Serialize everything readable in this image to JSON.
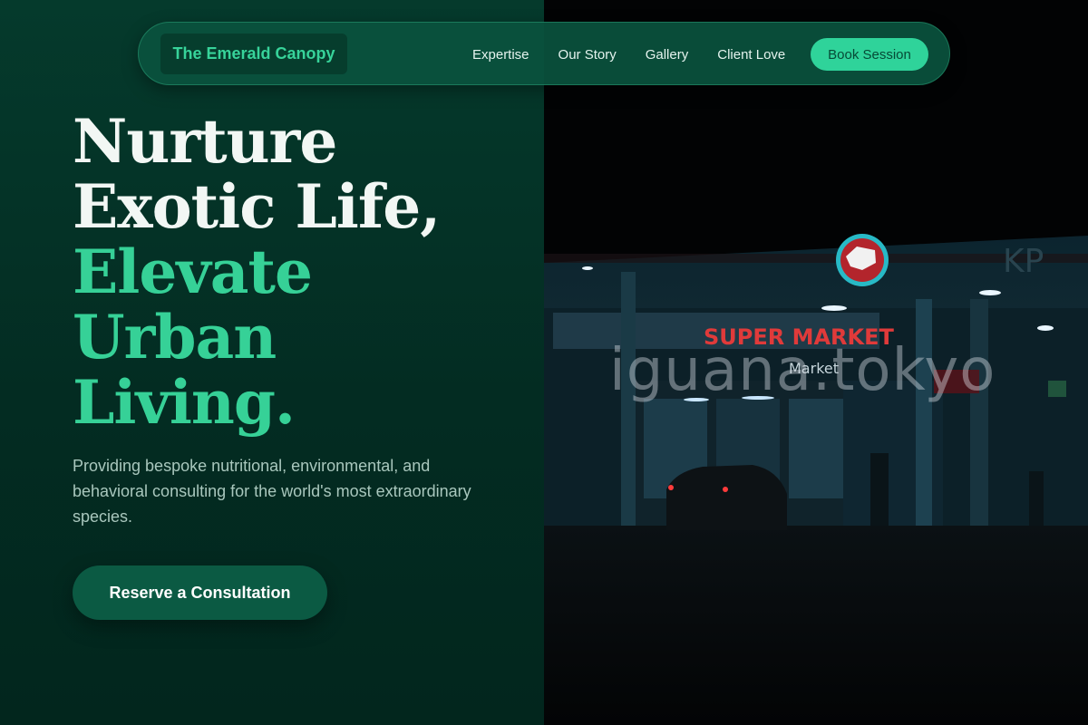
{
  "nav": {
    "brand": "The Emerald Canopy",
    "links": [
      "Expertise",
      "Our Story",
      "Gallery",
      "Client Love"
    ],
    "cta": "Book Session"
  },
  "hero": {
    "title_lines_white": [
      "Nurture",
      "Exotic Life,"
    ],
    "title_lines_green": [
      "Elevate",
      "Urban",
      "Living."
    ],
    "subtitle": "Providing bespoke nutritional, environmental, and behavioral consulting for the world's most extraordinary species.",
    "cta": "Reserve a Consultation"
  },
  "photo": {
    "watermark": "iguana.tokyo",
    "sign_text": "SUPER MARKET",
    "sign_subtext": "Market",
    "corner_sign": "KP"
  },
  "colors": {
    "accent": "#36d197",
    "panel_bg": "#032c22",
    "nav_bg": "#0a523e",
    "cta_bg": "#0b5a43"
  }
}
